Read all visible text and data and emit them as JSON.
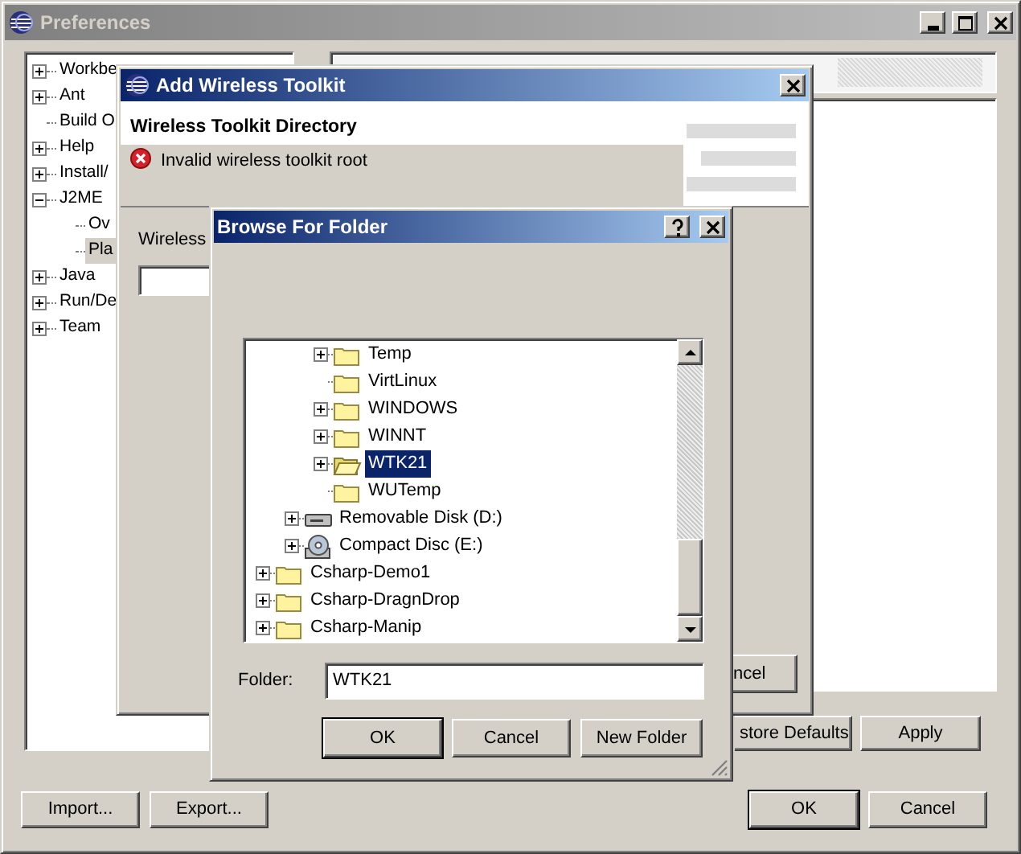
{
  "preferences": {
    "title": "Preferences",
    "tree": [
      {
        "label": "Workbe",
        "expandable": true,
        "expanded": false,
        "selected": false
      },
      {
        "label": "Ant",
        "expandable": true,
        "expanded": false,
        "selected": false
      },
      {
        "label": "Build O",
        "expandable": false,
        "selected": false
      },
      {
        "label": "Help",
        "expandable": true,
        "expanded": false,
        "selected": false
      },
      {
        "label": "Install/",
        "expandable": true,
        "expanded": false,
        "selected": false
      },
      {
        "label": "J2ME",
        "expandable": true,
        "expanded": true,
        "selected": false,
        "children": [
          {
            "label": "Ov",
            "expandable": false,
            "selected": false
          },
          {
            "label": "Pla",
            "expandable": false,
            "selected": true
          }
        ]
      },
      {
        "label": "Java",
        "expandable": true,
        "expanded": false,
        "selected": false
      },
      {
        "label": "Run/De",
        "expandable": true,
        "expanded": false,
        "selected": false
      },
      {
        "label": "Team",
        "expandable": true,
        "expanded": false,
        "selected": false
      }
    ],
    "page_buttons": [
      {
        "label": "store Defaults",
        "default": false
      },
      {
        "label": "Apply",
        "default": false
      }
    ],
    "left_buttons": [
      {
        "label": "Import...",
        "default": false
      },
      {
        "label": "Export...",
        "default": false
      }
    ],
    "right_buttons": [
      {
        "label": "OK",
        "default": true
      },
      {
        "label": "Cancel",
        "default": false
      }
    ]
  },
  "add_toolkit_dialog": {
    "title": "Add Wireless Toolkit",
    "heading": "Wireless Toolkit Directory",
    "error": "Invalid wireless toolkit root",
    "field_label": "Wireless",
    "button": {
      "label": "ncel",
      "default": false
    }
  },
  "browse_dialog": {
    "title": "Browse For Folder",
    "tree": [
      {
        "children": [
          {
            "children": [
              {
                "label": "Temp",
                "kind": "folder",
                "expandable": true,
                "selected": false
              },
              {
                "label": "VirtLinux",
                "kind": "folder",
                "expandable": false,
                "selected": false
              },
              {
                "label": "WINDOWS",
                "kind": "folder",
                "expandable": true,
                "selected": false
              },
              {
                "label": "WINNT",
                "kind": "folder",
                "expandable": true,
                "selected": false
              },
              {
                "label": "WTK21",
                "kind": "folder",
                "expandable": true,
                "selected": true
              },
              {
                "label": "WUTemp",
                "kind": "folder",
                "expandable": false,
                "selected": false
              }
            ]
          },
          {
            "label": "Removable Disk (D:)",
            "kind": "drive",
            "expandable": true,
            "selected": false
          },
          {
            "label": "Compact Disc (E:)",
            "kind": "disc",
            "expandable": true,
            "selected": false
          }
        ]
      },
      {
        "label": "Csharp-Demo1",
        "kind": "folder",
        "expandable": true,
        "selected": false
      },
      {
        "label": "Csharp-DragnDrop",
        "kind": "folder",
        "expandable": true,
        "selected": false
      },
      {
        "label": "Csharp-Manip",
        "kind": "folder",
        "expandable": true,
        "selected": false
      }
    ],
    "folder_label": "Folder:",
    "folder_value": "WTK21",
    "buttons": [
      {
        "label": "OK",
        "default": true
      },
      {
        "label": "Cancel",
        "default": false
      },
      {
        "label": "New Folder",
        "default": false
      }
    ]
  }
}
